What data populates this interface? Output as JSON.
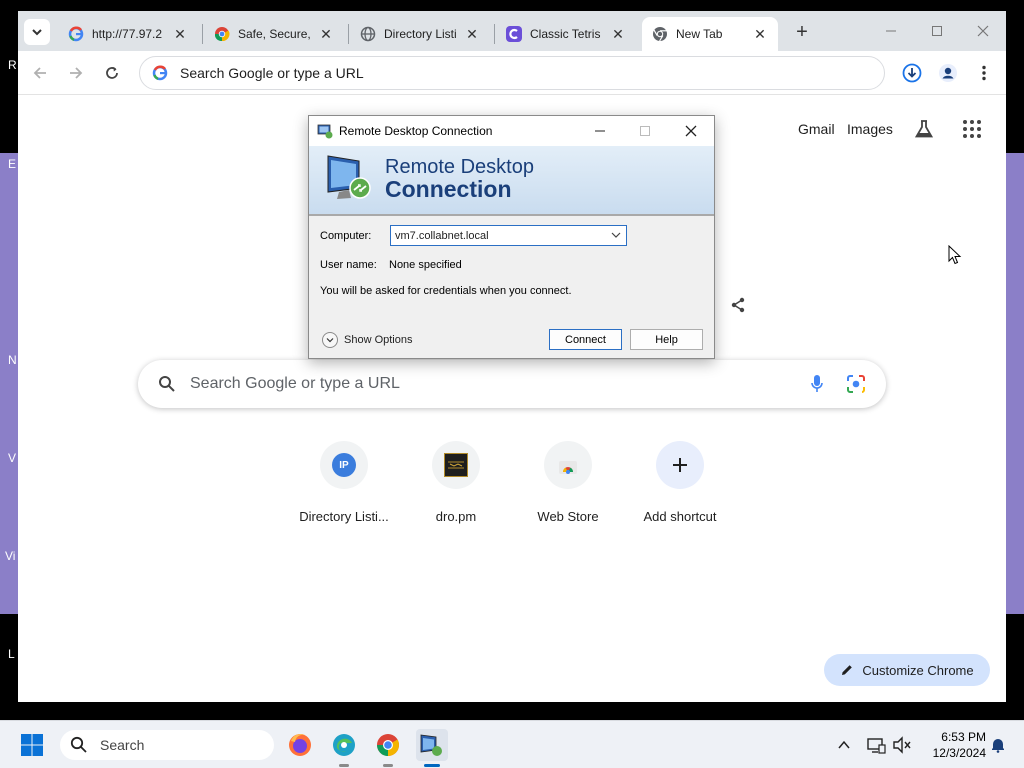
{
  "desktop": {
    "fragments": [
      "R",
      "E",
      "N",
      "V",
      "Vi",
      "L"
    ]
  },
  "browser": {
    "tabs": [
      {
        "title": "http://77.97.2",
        "favicon": "google-g-icon"
      },
      {
        "title": "Safe, Secure, ",
        "favicon": "chrome-icon"
      },
      {
        "title": "Directory Listi",
        "favicon": "globe-icon"
      },
      {
        "title": "Classic Tetris",
        "favicon": "tetris-c-icon"
      },
      {
        "title": "New Tab",
        "favicon": "chrome-icon",
        "active": true
      }
    ],
    "omnibox_placeholder": "Search Google or type a URL"
  },
  "ntp": {
    "gmail": "Gmail",
    "images": "Images",
    "search_placeholder": "Search Google or type a URL",
    "shortcuts": [
      {
        "label": "Directory Listi...",
        "icon": "ip-icon"
      },
      {
        "label": "dro.pm",
        "icon": "dro-pm-thumbnail"
      },
      {
        "label": "Web Store",
        "icon": "chrome-webstore-icon"
      },
      {
        "label": "Add shortcut",
        "icon": "plus-icon"
      }
    ],
    "customize": "Customize Chrome",
    "ip_badge": "IP"
  },
  "rdp": {
    "window_title": "Remote Desktop Connection",
    "banner_line1": "Remote Desktop",
    "banner_line2": "Connection",
    "computer_label": "Computer:",
    "computer_value": "vm7.collabnet.local",
    "username_label": "User name:",
    "username_value": "None specified",
    "info": "You will be asked for credentials when you connect.",
    "show_options": "Show Options",
    "connect": "Connect",
    "help": "Help"
  },
  "taskbar": {
    "search": "Search",
    "time": "6:53 PM",
    "date": "12/3/2024"
  }
}
